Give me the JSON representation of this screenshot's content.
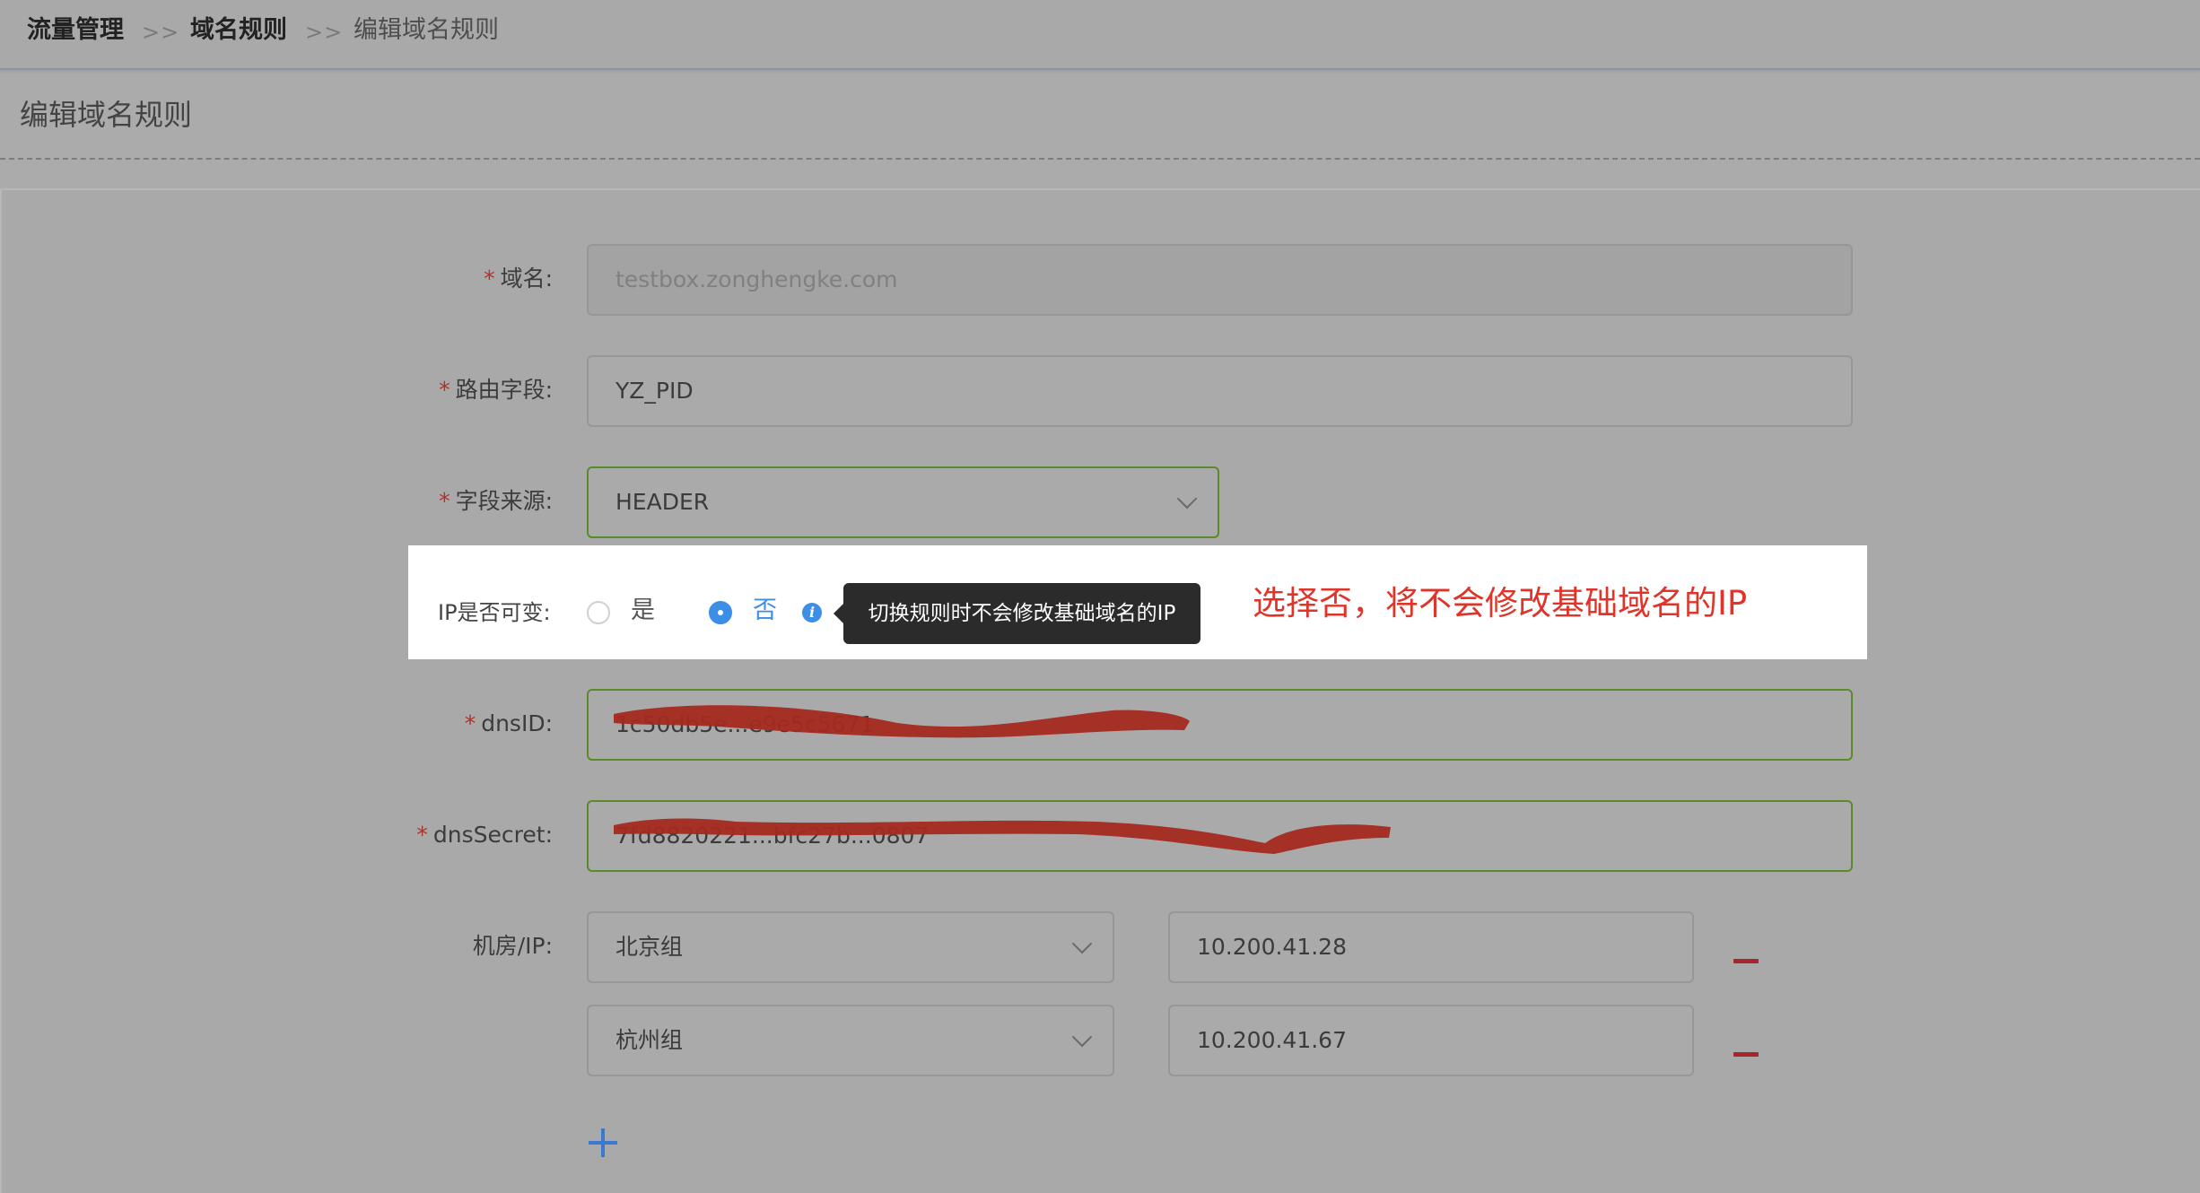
{
  "breadcrumb": {
    "item1": "流量管理",
    "sep": ">>",
    "item2": "域名规则",
    "item3": "编辑域名规则"
  },
  "page_title": "编辑域名规则",
  "form": {
    "required_mark": "*",
    "domain": {
      "label": "域名:",
      "value": "testbox.zonghengke.com"
    },
    "route_field": {
      "label": "路由字段:",
      "value": "YZ_PID"
    },
    "field_source": {
      "label": "字段来源:",
      "value": "HEADER"
    },
    "ip_mutable": {
      "label": "IP是否可变:",
      "options": [
        "是",
        "否"
      ],
      "selected": "否",
      "tooltip": "切换规则时不会修改基础域名的IP"
    },
    "dns_id": {
      "label": "dnsID:",
      "value": "1c50db5e...e9e5c5671"
    },
    "dns_secret": {
      "label": "dnsSecret:",
      "value": "7fd8820221...bfc27b...0807"
    },
    "room_ip": {
      "label": "机房/IP:",
      "rows": [
        {
          "room": "北京组",
          "ip": "10.200.41.28"
        },
        {
          "room": "杭州组",
          "ip": "10.200.41.67"
        }
      ]
    }
  },
  "annotation": "选择否，将不会修改基础域名的IP",
  "colors": {
    "required": "#b3312a",
    "primary": "#3c8ee6",
    "annotation": "#e0342a",
    "redaction": "#a3291f",
    "remove": "#a8262b",
    "focus_border": "#5a8a2a"
  }
}
